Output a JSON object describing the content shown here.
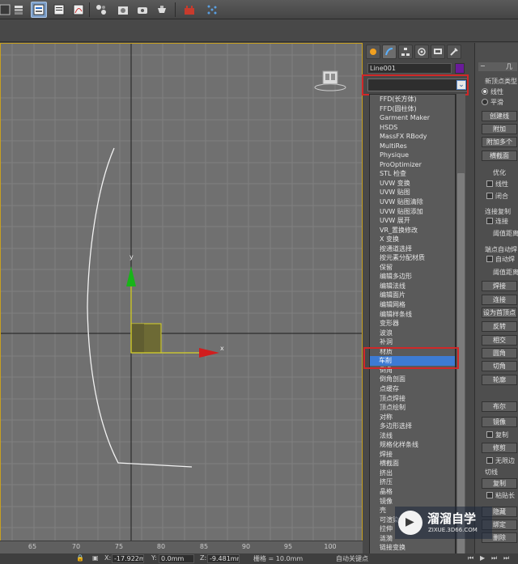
{
  "toolbar": {
    "icons": [
      "grid-icon",
      "layers-icon",
      "scene-explorer-icon",
      "curve-editor-icon",
      "schematic-icon",
      "material-editor-icon",
      "render-setup-icon",
      "render-frame-icon",
      "render-icon",
      "massfx-icon",
      "particle-icon"
    ]
  },
  "command_panel": {
    "tab_icons": [
      "create-icon",
      "modify-icon",
      "hierarchy-icon",
      "motion-icon",
      "display-icon",
      "utilities-icon"
    ],
    "object_name": "Line001",
    "object_color": "#6a1b9a",
    "modifier_list": {
      "value": "",
      "items": [
        "FFD(长方体)",
        "FFD(圆柱体)",
        "Garment Maker",
        "HSDS",
        "MassFX RBody",
        "MultiRes",
        "Physique",
        "ProOptimizer",
        "STL 检查",
        "UVW 变换",
        "UVW 贴图",
        "UVW 贴图清除",
        "UVW 贴图添加",
        "UVW 展开",
        "VR_置换修改",
        "X 变换",
        "按通道选择",
        "按元素分配材质",
        "保留",
        "编辑多边形",
        "编辑法线",
        "编辑面片",
        "编辑网格",
        "编辑样条线",
        "变形器",
        "波浪",
        "补洞",
        "材质",
        "车削",
        "倒角",
        "倒角剖面",
        "点缓存",
        "顶点焊接",
        "顶点绘制",
        "对称",
        "多边形选择",
        "法线",
        "规格化样条线",
        "焊接",
        "横截面",
        "挤出",
        "挤压",
        "晶格",
        "镜像",
        "壳",
        "可渲染样条线",
        "拉伸",
        "涟漪",
        "链接变换",
        "路径变形",
        "蒙皮"
      ],
      "selected_index": 28
    }
  },
  "rollout": {
    "header": "几",
    "vertex_type_label": "新顶点类型",
    "radio_linear": "线性",
    "radio_smooth": "平滑",
    "btn_create_line": "创建线",
    "btn_attach": "附加",
    "btn_attach_multi": "附加多个",
    "btn_cross_section": "横截面",
    "optimize_label": "优化",
    "chk_linear": "线性",
    "chk_closed": "闭合",
    "connect_copy_label": "连接复制",
    "chk_connect": "连接",
    "threshold_label": "阈值距离",
    "end_auto_label": "端点自动焊",
    "chk_auto_weld": "自动焊",
    "threshold2_label": "阈值距离",
    "btn_weld": "焊接",
    "btn_connect": "连接",
    "btn_make_first": "设为首顶点",
    "btn_reverse": "反转",
    "btn_intersect": "相交",
    "btn_fillet": "圆角",
    "btn_chamfer": "切角",
    "btn_outline": "轮廓",
    "btn_boolean": "布尔",
    "btn_mirror": "镜像",
    "chk_copy": "复制",
    "btn_trim": "修剪",
    "chk_infinite": "无限边",
    "tangent_label": "切线",
    "btn_copy": "复制",
    "chk_paste_len": "粘贴长",
    "btn_hide": "隐藏",
    "btn_bind": "绑定",
    "btn_delete": "删除"
  },
  "viewport": {
    "axis_y": "y",
    "axis_x": "x"
  },
  "ruler": {
    "labels": [
      "65",
      "70",
      "75",
      "80",
      "85",
      "90",
      "95",
      "100"
    ]
  },
  "status": {
    "x_label": "X:",
    "x_value": "-17.922mm",
    "y_label": "Y:",
    "y_value": "0.0mm",
    "z_label": "Z:",
    "z_value": "-9.481mm",
    "grid": "栅格 = 10.0mm",
    "auto_key": "自动关键点"
  },
  "watermark": {
    "title": "溜溜自学",
    "url": "ZIXUE.3D66.COM"
  }
}
